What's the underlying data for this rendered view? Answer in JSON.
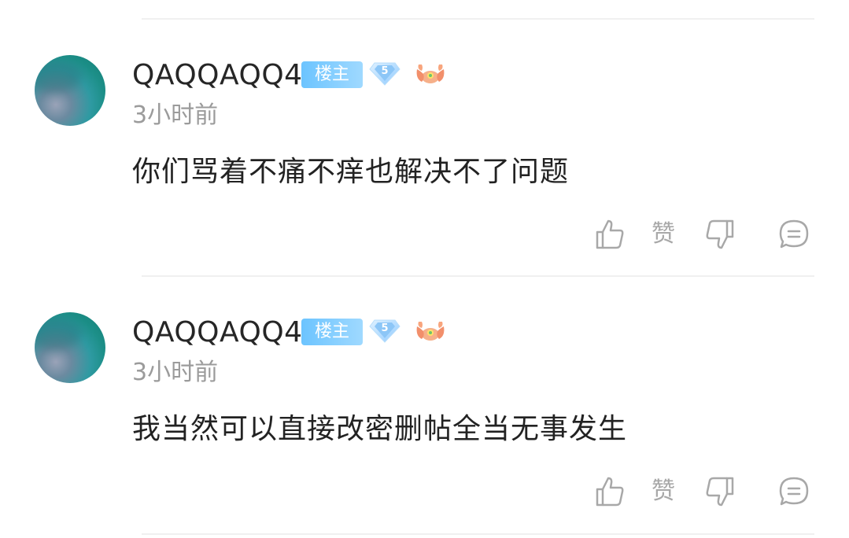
{
  "comments": [
    {
      "username": "QAQQAQQ4",
      "host_badge": "楼主",
      "level": "5",
      "time": "3小时前",
      "text": "你们骂着不痛不痒也解决不了问题",
      "like_label": "赞"
    },
    {
      "username": "QAQQAQQ4",
      "host_badge": "楼主",
      "level": "5",
      "time": "3小时前",
      "text": "我当然可以直接改密删帖全当无事发生",
      "like_label": "赞"
    }
  ],
  "colors": {
    "host_badge": "#8ccfff",
    "muted_text": "#9b9b9b",
    "icon_gray": "#a8a8a8"
  },
  "icons": {
    "like": "thumbs-up-outline",
    "dislike": "thumbs-down-outline",
    "reply": "speech-bubble-outline",
    "level": "diamond-level-badge",
    "decoration": "crab-emblem"
  }
}
